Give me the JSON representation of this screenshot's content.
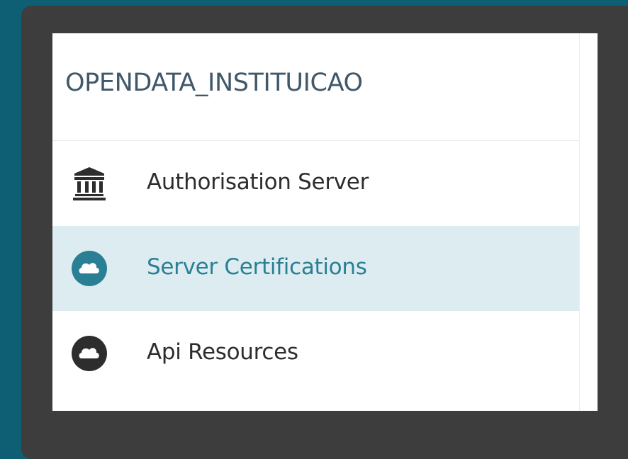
{
  "organisation": {
    "title": "OPENDATA_INSTITUICAO"
  },
  "nav": {
    "items": [
      {
        "label": "Authorisation Server",
        "icon": "bank-icon",
        "active": false
      },
      {
        "label": "Server Certifications",
        "icon": "cloud-icon",
        "active": true
      },
      {
        "label": "Api Resources",
        "icon": "cloud-icon",
        "active": false
      }
    ]
  },
  "colors": {
    "background": "#0f5f74",
    "frame": "#3d3d3d",
    "active_bg": "#ddecf0",
    "active_text": "#2a7f94",
    "text": "#2d2d2d",
    "title_text": "#415869"
  }
}
